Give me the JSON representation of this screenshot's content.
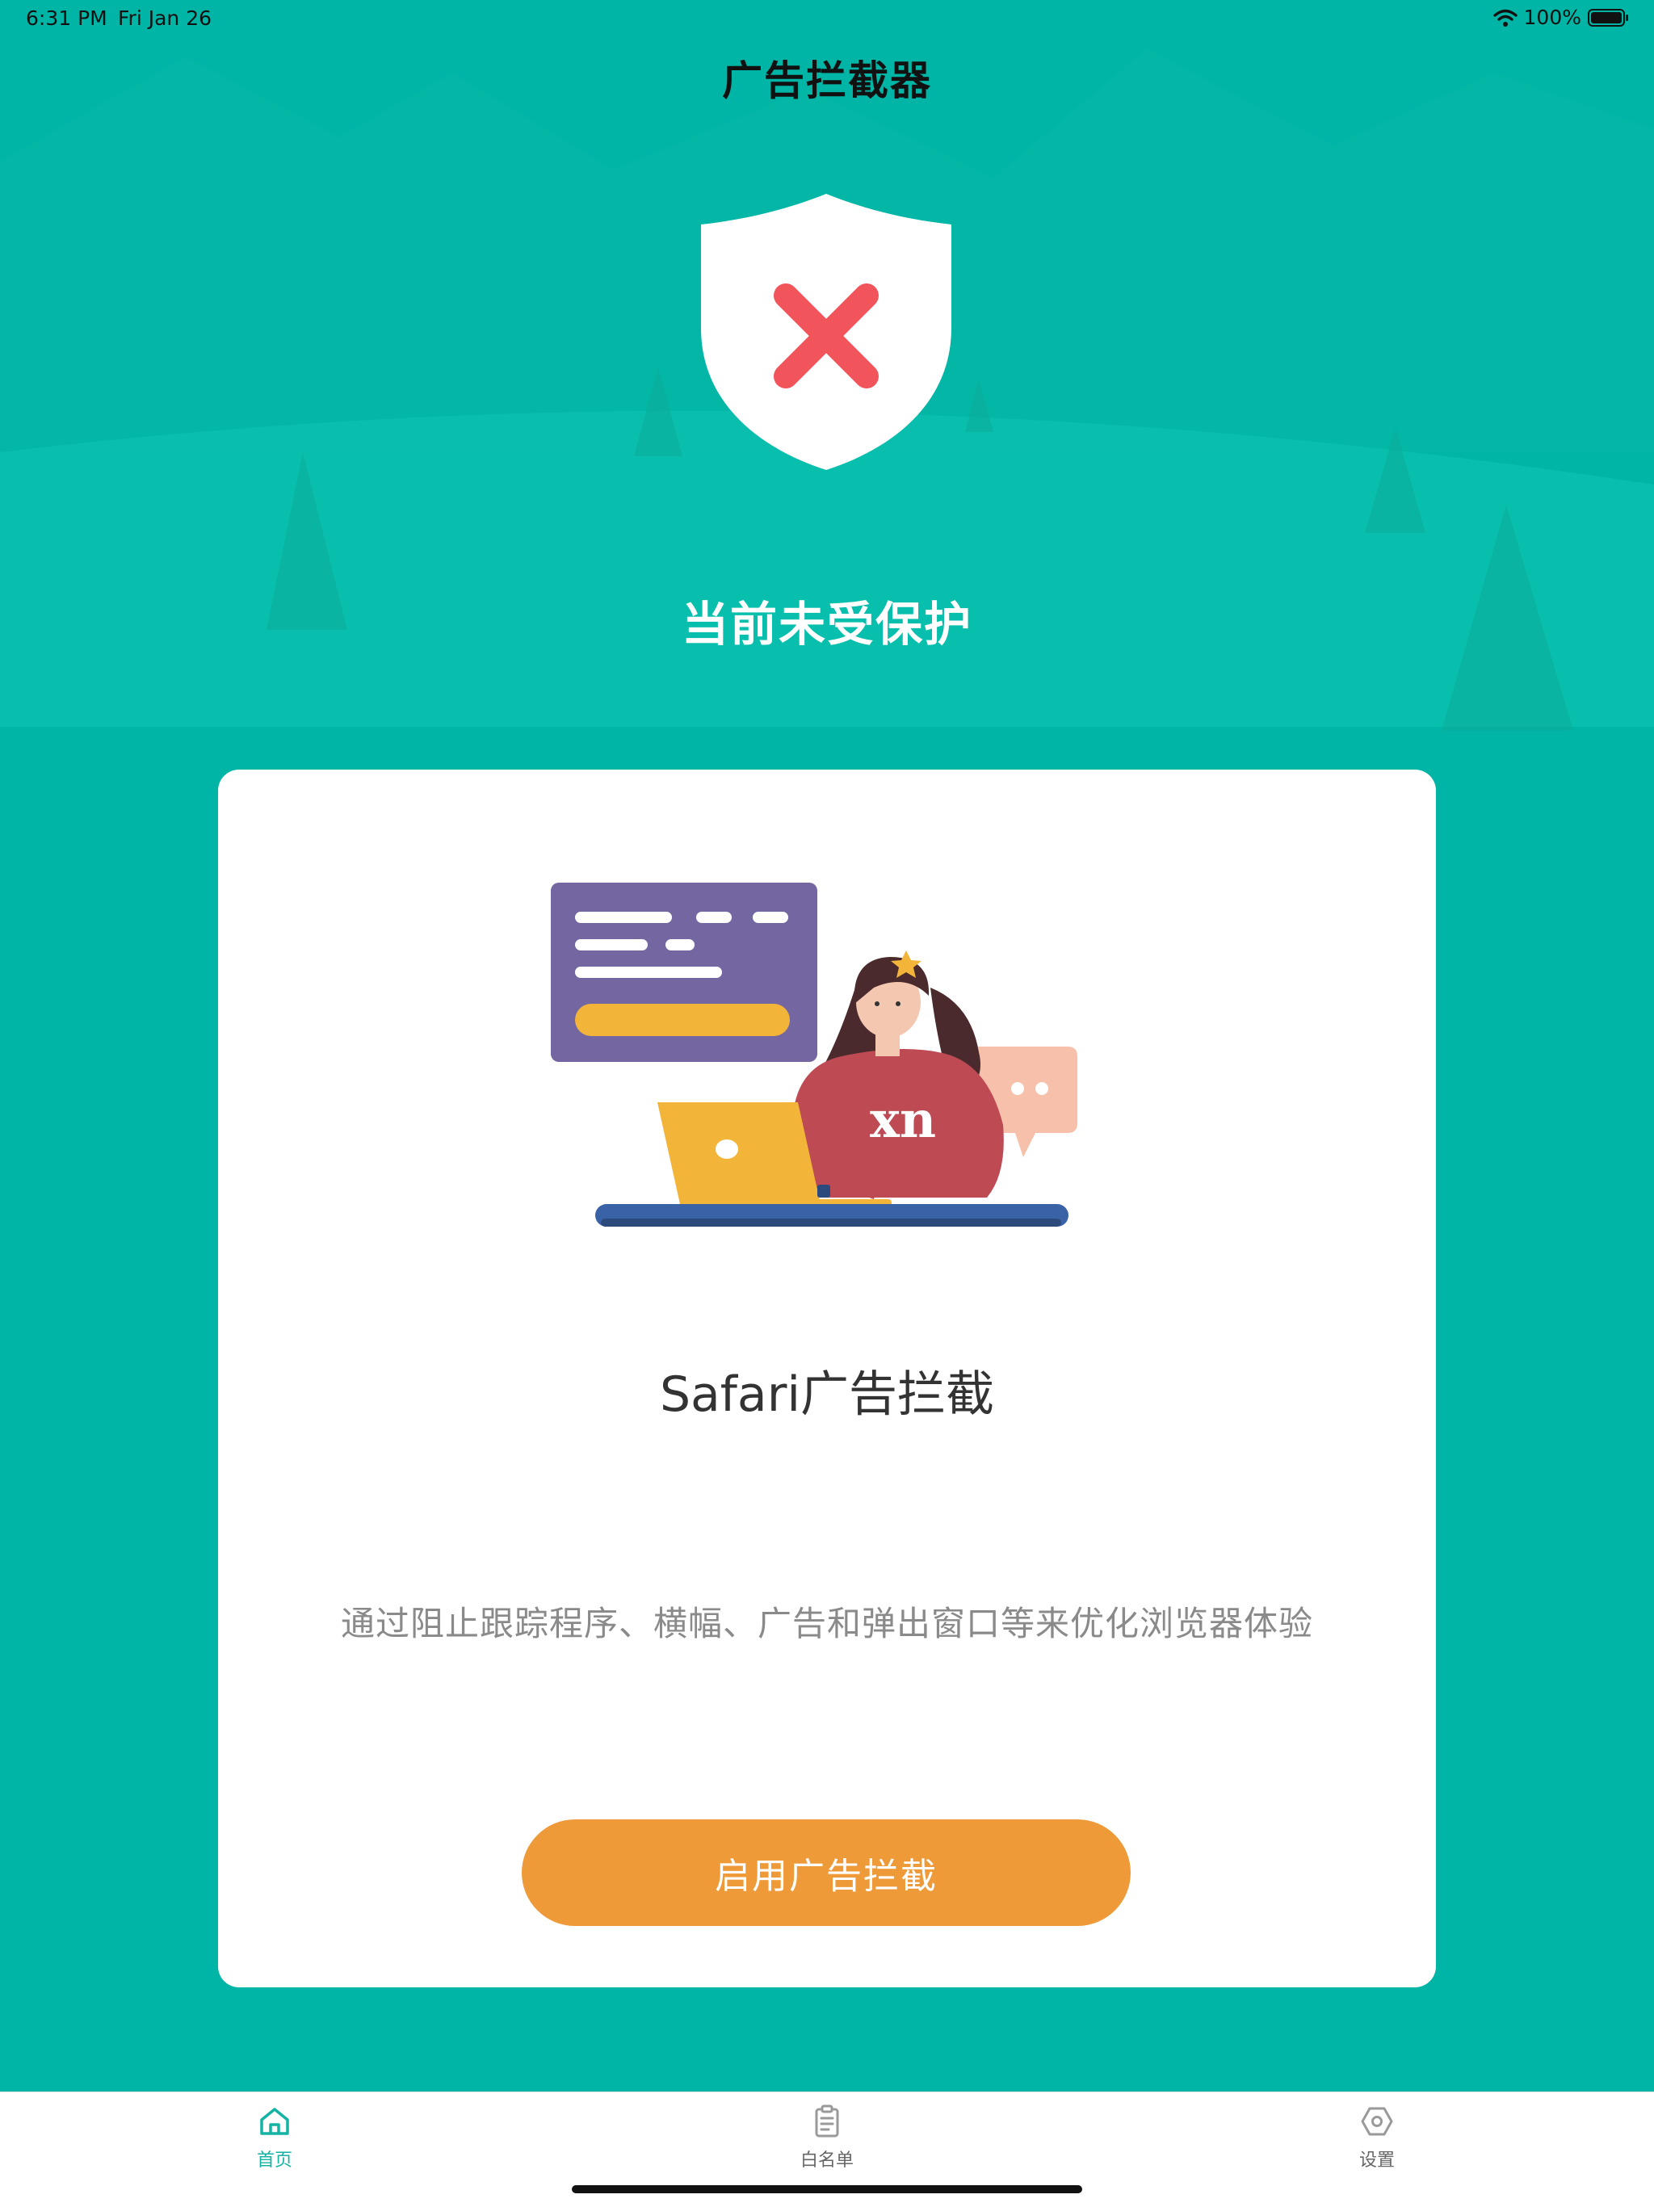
{
  "status_bar": {
    "time": "6:31 PM",
    "date": "Fri Jan 26",
    "battery": "100%"
  },
  "nav": {
    "title": "广告拦截器"
  },
  "protection": {
    "status_text": "当前未受保护",
    "icon": "shield-x-icon"
  },
  "card": {
    "title": "Safari广告拦截",
    "description": "通过阻止跟踪程序、横幅、广告和弹出窗口等来优化浏览器体验",
    "button_label": "启用广告拦截",
    "illustration_shirt_text": "xn"
  },
  "tabs": [
    {
      "label": "首页",
      "icon": "home-icon",
      "active": true
    },
    {
      "label": "白名单",
      "icon": "clipboard-list-icon",
      "active": false
    },
    {
      "label": "设置",
      "icon": "gear-hexagon-icon",
      "active": false
    }
  ],
  "colors": {
    "background": "#00b5a5",
    "button": "#ef9a38",
    "accent": "#14b3a3",
    "danger": "#f2545b"
  }
}
